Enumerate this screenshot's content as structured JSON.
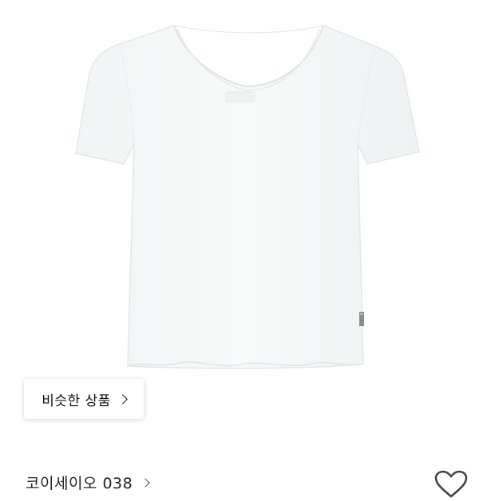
{
  "product_image": {
    "icon": "white-tshirt-product-photo"
  },
  "similar_products_button": {
    "label": "비슷한 상품",
    "icon": "chevron-right-icon"
  },
  "brand": {
    "name": "코이세이오 038",
    "icon": "chevron-right-icon"
  },
  "wishlist": {
    "icon": "heart-outline-icon",
    "color": "#444444"
  }
}
